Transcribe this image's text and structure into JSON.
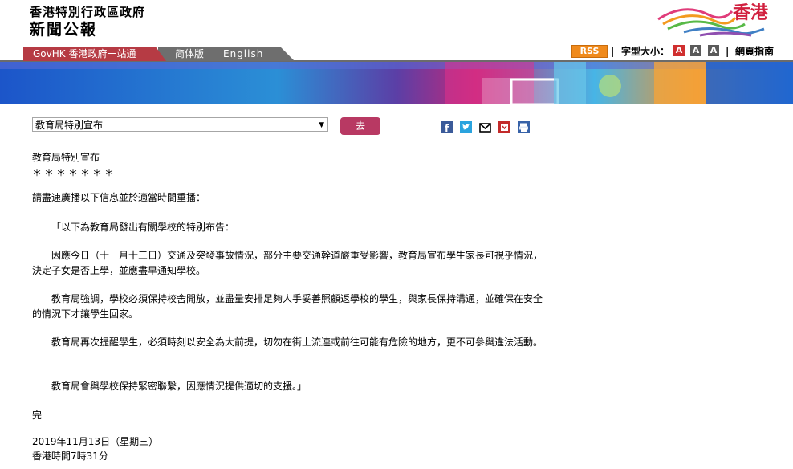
{
  "header": {
    "agency": "香港特別行政區政府",
    "site_name": "新聞公報",
    "logo_text": "香港"
  },
  "nav": {
    "govhk": "GovHK 香港政府一站通",
    "simplified": "简体版",
    "english": "English"
  },
  "tools": {
    "rss": "RSS",
    "font_size_label": "字型大小：",
    "font_sizes": [
      "A",
      "A",
      "A"
    ],
    "guide": "網頁指南"
  },
  "selector": {
    "selected": "教育局特別宣布",
    "go_label": "去"
  },
  "share_icons": [
    "facebook-icon",
    "twitter-icon",
    "email-icon",
    "save-icon",
    "print-icon"
  ],
  "article": {
    "title": "教育局特別宣布",
    "stars": "＊＊＊＊＊＊＊",
    "intro": "請盡速廣播以下信息並於適當時間重播：",
    "p1": "「以下為教育局發出有關學校的特別布告：",
    "p2": "因應今日（十一月十三日）交通及突發事故情況，部分主要交通幹道嚴重受影響，教育局宣布學生家長可視乎情況，決定子女是否上學，並應盡早通知學校。",
    "p3": "教育局強調，學校必須保持校舍開放，並盡量安排足夠人手妥善照顧返學校的學生，與家長保持溝通，並確保在安全的情況下才讓學生回家。",
    "p4": "教育局再次提醒學生，必須時刻以安全為大前提，切勿在街上流連或前往可能有危險的地方，更不可參與違法活動。",
    "p5": "教育局會與學校保持緊密聯繫，因應情況提供適切的支援。」",
    "end": "完",
    "date": "2019年11月13日（星期三）",
    "time": "香港時間7時31分"
  },
  "colors": {
    "govhk_tab": "#b63b44",
    "lang_tab": "#6e6e6e",
    "go_button": "#b83963",
    "rss": "#f08a1c"
  }
}
